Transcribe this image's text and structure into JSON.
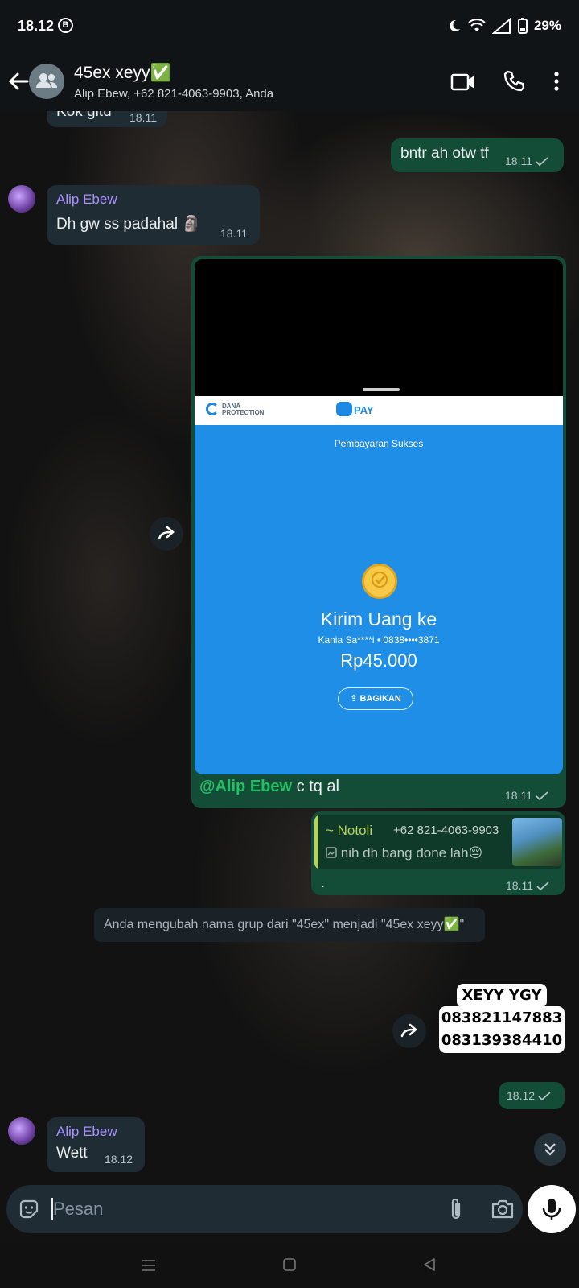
{
  "status_bar": {
    "time": "18.12",
    "badge": "B",
    "battery": "29%"
  },
  "header": {
    "title": "45ex xeyy✅",
    "subtitle": "Alip Ebew, +62 821-4063-9903, Anda"
  },
  "messages": {
    "partial": {
      "text": "Kok gitu",
      "time": "18.11"
    },
    "bntr": {
      "text": "bntr ah otw tf",
      "time": "18.11"
    },
    "dh": {
      "sender": "Alip Ebew",
      "text": "Dh gw ss padahal 🗿",
      "time": "18.11"
    },
    "image": {
      "dana_logo_line1": "DANA",
      "dana_logo_line2": "PROTECTION",
      "pay_label": "PAY",
      "success_text": "Pembayaran Sukses",
      "title": "Kirim Uang ke",
      "recipient": "Kania Sa****i • 0838••••3871",
      "amount": "Rp45.000",
      "share_label": "BAGIKAN",
      "caption_mention": "@Alip Ebew",
      "caption_text": " c tq al",
      "time": "18.11"
    },
    "reply": {
      "quote_name": "~ Notoli",
      "quote_phone": "+62 821-4063-9903",
      "quote_text": "nih dh bang done lah😔",
      "text": ".",
      "time": "18.11"
    },
    "system": "Anda mengubah nama grup dari \"45ex\" menjadi \"45ex xeyy✅\"",
    "sticker": {
      "line1": "XEYY YGY",
      "line2": "083821147883",
      "line3": "083139384410"
    },
    "sticker_time": "18.12",
    "wett": {
      "sender": "Alip Ebew",
      "text": "Wett",
      "time": "18.12"
    }
  },
  "input": {
    "placeholder": "Pesan"
  },
  "colors": {
    "outgoing": "#144d37",
    "incoming": "#1f2c34",
    "accent": "#21c063",
    "sender": "#a98fff"
  }
}
